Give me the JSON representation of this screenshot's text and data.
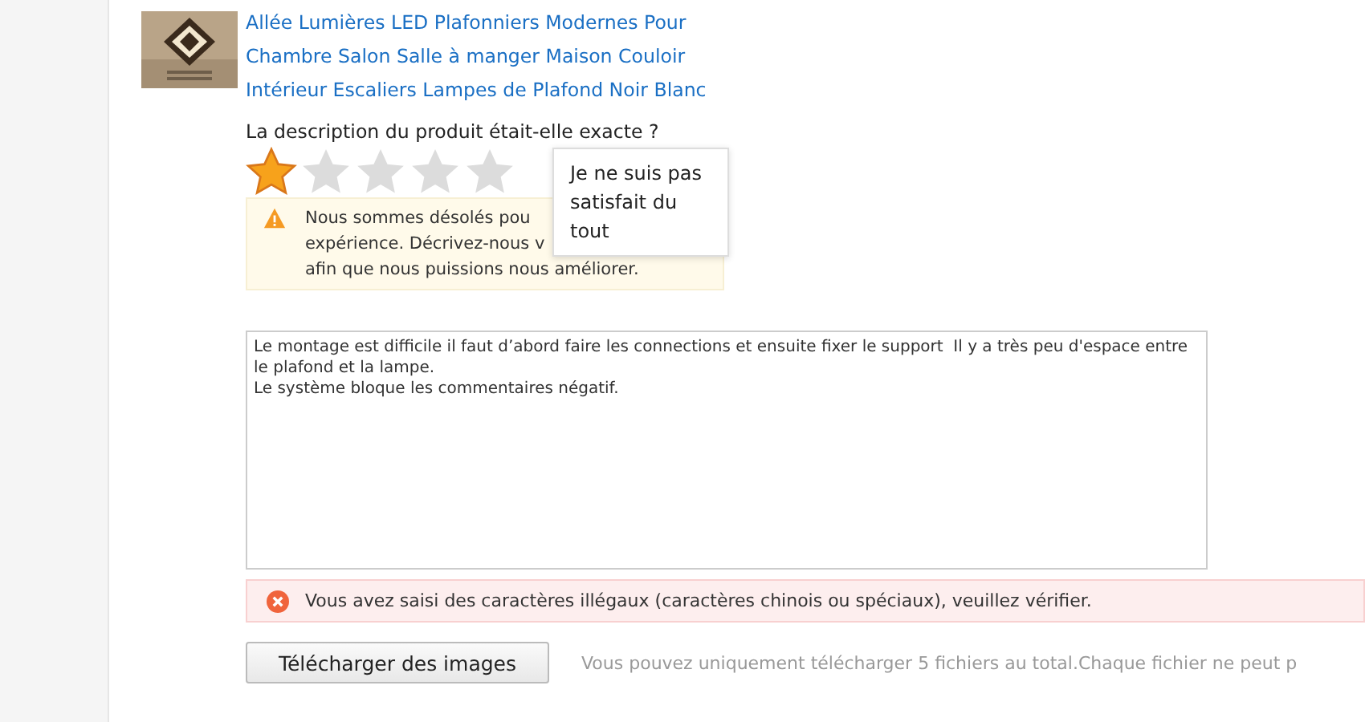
{
  "product": {
    "title": "Allée Lumières LED Plafonniers Modernes Pour Chambre Salon Salle à manger Maison Couloir Intérieur Escaliers Lampes de Plafond Noir Blanc"
  },
  "rating": {
    "question": "La description du produit était-elle exacte ?",
    "stars": 1,
    "tooltip": "Je ne suis pas satisfait du tout"
  },
  "warning": {
    "lines": [
      "Nous sommes désolés pou",
      "expérience. Décrivez-nous v",
      "afin que nous puissions nous améliorer."
    ]
  },
  "review": {
    "value": "Le montage est difficile il faut d’abord faire les connections et ensuite fixer le support  Il y a très peu d'espace entre le plafond et la lampe.\nLe système bloque les commentaires négatif."
  },
  "error": {
    "message": "Vous avez saisi des caractères illégaux (caractères chinois ou spéciaux), veuillez vérifier."
  },
  "upload": {
    "button": "Télécharger des images",
    "hint": "Vous pouvez uniquement télécharger 5 fichiers au total.Chaque fichier ne peut p"
  }
}
